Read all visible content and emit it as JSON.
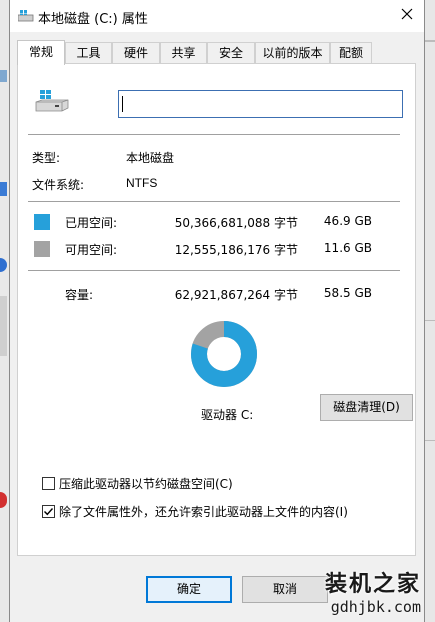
{
  "window": {
    "title": "本地磁盘 (C:) 属性"
  },
  "tabs": [
    {
      "label": "常规",
      "active": true
    },
    {
      "label": "工具"
    },
    {
      "label": "硬件"
    },
    {
      "label": "共享"
    },
    {
      "label": "安全"
    },
    {
      "label": "以前的版本"
    },
    {
      "label": "配额"
    }
  ],
  "general": {
    "name_value": "",
    "type_label": "类型:",
    "type_value": "本地磁盘",
    "fs_label": "文件系统:",
    "fs_value": "NTFS",
    "used_label": "已用空间:",
    "used_bytes": "50,366,681,088 字节",
    "used_size": "46.9 GB",
    "free_label": "可用空间:",
    "free_bytes": "12,555,186,176 字节",
    "free_size": "11.6 GB",
    "capacity_label": "容量:",
    "capacity_bytes": "62,921,867,264 字节",
    "capacity_size": "58.5 GB",
    "drive_label": "驱动器 C:",
    "cleanup_button": "磁盘清理(D)",
    "compress_label": "压缩此驱动器以节约磁盘空间(C)",
    "compress_checked": false,
    "index_label": "除了文件属性外，还允许索引此驱动器上文件的内容(I)",
    "index_checked": true
  },
  "footer": {
    "ok_button": "确定",
    "cancel_button": "取消"
  },
  "watermark": {
    "text": "装机之家",
    "url": "gdhjbk.com"
  },
  "colors": {
    "used": "#26a0da",
    "free": "#a3a3a3",
    "accent": "#0078d7"
  },
  "chart_data": {
    "type": "pie",
    "categories": [
      "已用空间",
      "可用空间"
    ],
    "values": [
      50366681088,
      12555186176
    ],
    "colors": [
      "#26a0da",
      "#a3a3a3"
    ]
  }
}
